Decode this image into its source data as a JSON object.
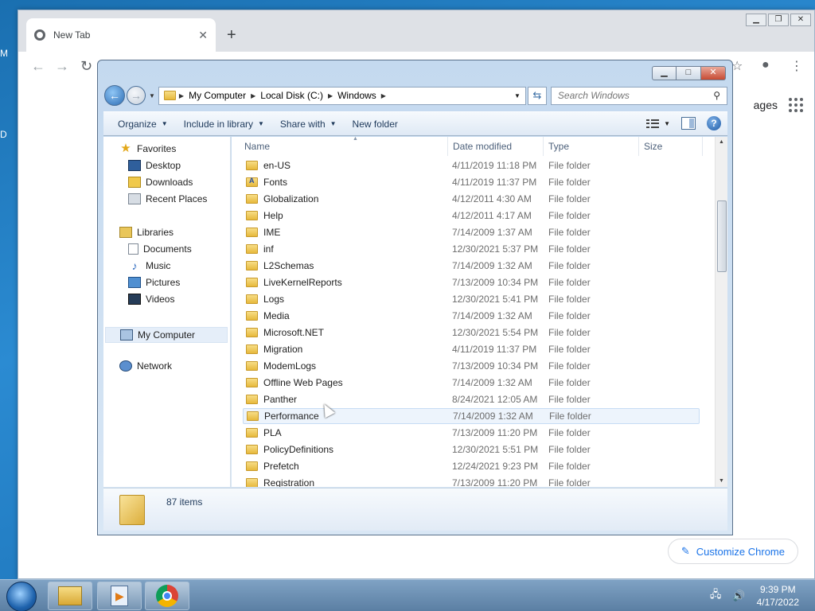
{
  "desktop": {
    "left_letters": [
      "M",
      "D"
    ]
  },
  "chrome": {
    "tab_title": "New Tab",
    "new_tab_symbol": "+",
    "right_link_fragment": "ages",
    "customize_label": "Customize Chrome"
  },
  "explorer": {
    "breadcrumb": [
      "My Computer",
      "Local Disk (C:)",
      "Windows"
    ],
    "search_placeholder": "Search Windows",
    "commands": {
      "organize": "Organize",
      "include_in_library": "Include in library",
      "share_with": "Share with",
      "new_folder": "New folder"
    },
    "nav": {
      "favorites": "Favorites",
      "desktop": "Desktop",
      "downloads": "Downloads",
      "recent_places": "Recent Places",
      "libraries": "Libraries",
      "documents": "Documents",
      "music": "Music",
      "pictures": "Pictures",
      "videos": "Videos",
      "my_computer": "My Computer",
      "network": "Network"
    },
    "columns": {
      "name": "Name",
      "date": "Date modified",
      "type": "Type",
      "size": "Size"
    },
    "files": [
      {
        "name": "en-US",
        "date": "4/11/2019 11:18 PM",
        "type": "File folder"
      },
      {
        "name": "Fonts",
        "date": "4/11/2019 11:37 PM",
        "type": "File folder"
      },
      {
        "name": "Globalization",
        "date": "4/12/2011 4:30 AM",
        "type": "File folder"
      },
      {
        "name": "Help",
        "date": "4/12/2011 4:17 AM",
        "type": "File folder"
      },
      {
        "name": "IME",
        "date": "7/14/2009 1:37 AM",
        "type": "File folder"
      },
      {
        "name": "inf",
        "date": "12/30/2021 5:37 PM",
        "type": "File folder"
      },
      {
        "name": "L2Schemas",
        "date": "7/14/2009 1:32 AM",
        "type": "File folder"
      },
      {
        "name": "LiveKernelReports",
        "date": "7/13/2009 10:34 PM",
        "type": "File folder"
      },
      {
        "name": "Logs",
        "date": "12/30/2021 5:41 PM",
        "type": "File folder"
      },
      {
        "name": "Media",
        "date": "7/14/2009 1:32 AM",
        "type": "File folder"
      },
      {
        "name": "Microsoft.NET",
        "date": "12/30/2021 5:54 PM",
        "type": "File folder"
      },
      {
        "name": "Migration",
        "date": "4/11/2019 11:37 PM",
        "type": "File folder"
      },
      {
        "name": "ModemLogs",
        "date": "7/13/2009 10:34 PM",
        "type": "File folder"
      },
      {
        "name": "Offline Web Pages",
        "date": "7/14/2009 1:32 AM",
        "type": "File folder"
      },
      {
        "name": "Panther",
        "date": "8/24/2021 12:05 AM",
        "type": "File folder"
      },
      {
        "name": "Performance",
        "date": "7/14/2009 1:32 AM",
        "type": "File folder"
      },
      {
        "name": "PLA",
        "date": "7/13/2009 11:20 PM",
        "type": "File folder"
      },
      {
        "name": "PolicyDefinitions",
        "date": "12/30/2021 5:51 PM",
        "type": "File folder"
      },
      {
        "name": "Prefetch",
        "date": "12/24/2021 9:23 PM",
        "type": "File folder"
      },
      {
        "name": "Registration",
        "date": "7/13/2009 11:20 PM",
        "type": "File folder"
      }
    ],
    "hovered_row": "Performance",
    "item_count": "87 items"
  },
  "taskbar": {
    "time": "9:39 PM",
    "date": "4/17/2022"
  }
}
